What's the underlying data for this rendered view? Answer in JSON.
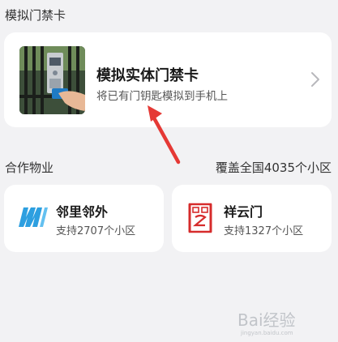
{
  "section_access": {
    "title": "模拟门禁卡"
  },
  "card_main": {
    "title": "模拟实体门禁卡",
    "subtitle": "将已有门钥匙模拟到手机上",
    "thumbnail_icon": "door-access-photo",
    "chevron_icon": "chevron-right-icon"
  },
  "cooperation": {
    "label": "合作物业",
    "coverage": "覆盖全国4035个小区"
  },
  "partners": [
    {
      "name": "邻里邻外",
      "count_text": "支持2707个小区",
      "logo_icon": "linli-logo-icon",
      "color": "#2d9fe0"
    },
    {
      "name": "祥云门",
      "count_text": "支持1327个小区",
      "logo_icon": "xiangyun-logo-icon",
      "color": "#d62c2c"
    }
  ],
  "watermark": {
    "text": "Bai经验",
    "sub": "jingyan.baidu.com"
  },
  "colors": {
    "background": "#f2f2f4",
    "card": "#ffffff",
    "arrow": "#e53935"
  }
}
